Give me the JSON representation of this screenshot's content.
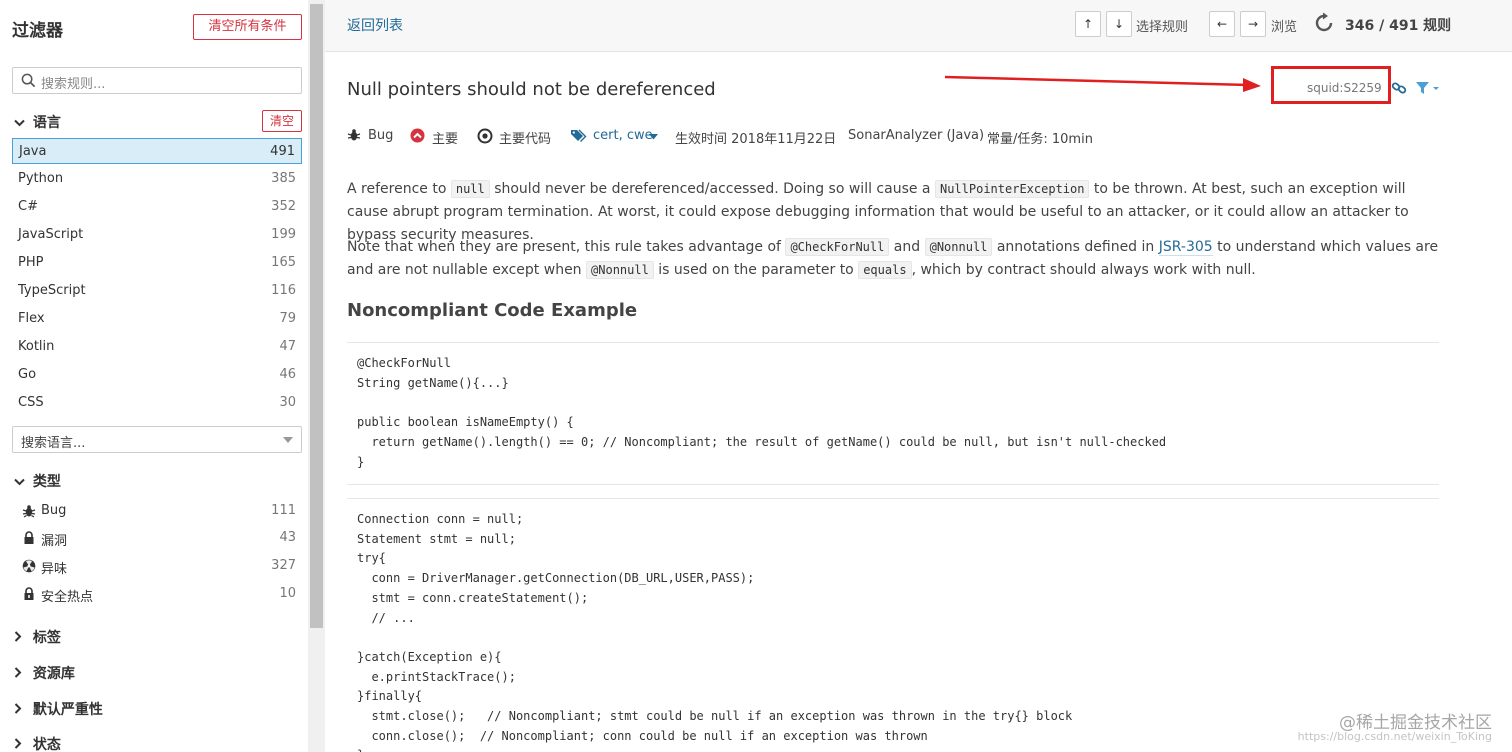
{
  "sidebar": {
    "title": "过滤器",
    "clear_all": "清空所有条件",
    "search_placeholder": "搜索规则...",
    "language": {
      "label": "语言",
      "clear": "清空",
      "items": [
        {
          "label": "Java",
          "count": "491",
          "selected": true
        },
        {
          "label": "Python",
          "count": "385"
        },
        {
          "label": "C#",
          "count": "352"
        },
        {
          "label": "JavaScript",
          "count": "199"
        },
        {
          "label": "PHP",
          "count": "165"
        },
        {
          "label": "TypeScript",
          "count": "116"
        },
        {
          "label": "Flex",
          "count": "79"
        },
        {
          "label": "Kotlin",
          "count": "47"
        },
        {
          "label": "Go",
          "count": "46"
        },
        {
          "label": "CSS",
          "count": "30"
        }
      ],
      "search_placeholder": "搜索语言..."
    },
    "type": {
      "label": "类型",
      "items": [
        {
          "label": "Bug",
          "count": "111",
          "icon": "bug-icon"
        },
        {
          "label": "漏洞",
          "count": "43",
          "icon": "lock-icon"
        },
        {
          "label": "异味",
          "count": "327",
          "icon": "code-smell-icon"
        },
        {
          "label": "安全热点",
          "count": "10",
          "icon": "security-hotspot-icon"
        }
      ]
    },
    "collapsed_facets": [
      "标签",
      "资源库",
      "默认严重性",
      "状态"
    ]
  },
  "topbar": {
    "back": "返回列表",
    "up": "↑",
    "down": "↓",
    "select_rule": "选择规则",
    "prev": "←",
    "next": "→",
    "browse": "浏览",
    "paging": "346 / 491 规则"
  },
  "rule": {
    "title": "Null pointers should not be dereferenced",
    "key": "squid:S2259",
    "meta": {
      "type": "Bug",
      "severity": "主要",
      "category": "主要代码",
      "tags": "cert, cwe",
      "date": "生效时间 2018年11月22日",
      "repo": "SonarAnalyzer (Java)",
      "effort": "常量/任务: 10min"
    },
    "p1": {
      "t1": "A reference to ",
      "c1": "null",
      "t2": " should never be dereferenced/accessed. Doing so will cause a ",
      "c2": "NullPointerException",
      "t3": " to be thrown. At best, such an exception will cause abrupt program termination. At worst, it could expose debugging information that would be useful to an attacker, or it could allow an attacker to bypass security measures."
    },
    "p2": {
      "t1": "Note that when they are present, this rule takes advantage of ",
      "c1": "@CheckForNull",
      "t2": " and ",
      "c2": "@Nonnull",
      "t3": " annotations defined in ",
      "link": "JSR-305",
      "t4": " to understand which values are and are not nullable except when ",
      "c3": "@Nonnull",
      "t5": " is used on the parameter to ",
      "c4": "equals",
      "t6": ", which by contract should always work with null."
    },
    "heading": "Noncompliant Code Example",
    "code1": "@CheckForNull\nString getName(){...}\n\npublic boolean isNameEmpty() {\n  return getName().length() == 0; // Noncompliant; the result of getName() could be null, but isn't null-checked\n}",
    "code2": "Connection conn = null;\nStatement stmt = null;\ntry{\n  conn = DriverManager.getConnection(DB_URL,USER,PASS);\n  stmt = conn.createStatement();\n  // ...\n\n}catch(Exception e){\n  e.printStackTrace();\n}finally{\n  stmt.close();   // Noncompliant; stmt could be null if an exception was thrown in the try{} block\n  conn.close();  // Noncompliant; conn could be null if an exception was thrown\n}"
  },
  "watermark": "@稀土掘金技术社区",
  "watermark_url": "https://blog.csdn.net/weixin_ToKing",
  "colors": {
    "link": "#236a97",
    "danger": "#d4333f",
    "selected_bg": "#d8edf8",
    "annotation_red": "#e02020"
  }
}
